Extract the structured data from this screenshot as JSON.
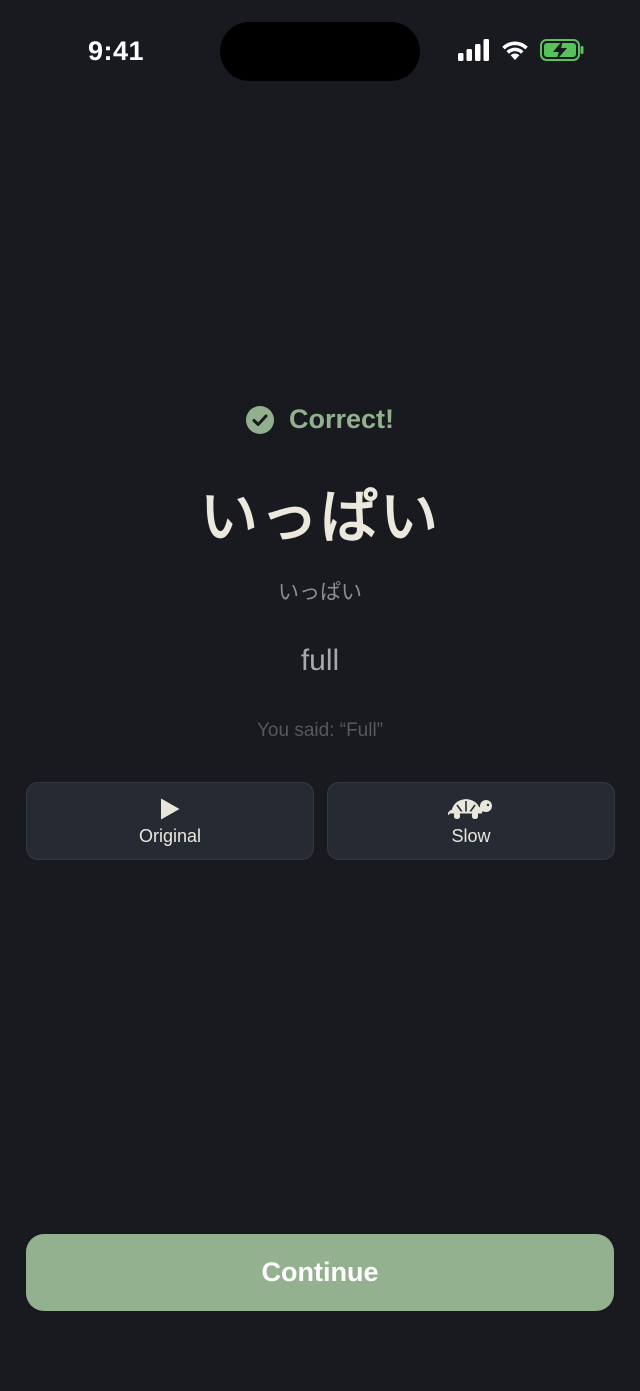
{
  "status_bar": {
    "time": "9:41",
    "icons": [
      "cellular-signal-icon",
      "wifi-icon",
      "battery-charging-icon"
    ]
  },
  "feedback": {
    "icon": "check-circle-icon",
    "text": "Correct!",
    "color": "#93b08e"
  },
  "card": {
    "word": "いっぱい",
    "reading": "いっぱい",
    "meaning": "full",
    "you_said": "You said: “Full”"
  },
  "audio_buttons": {
    "original": {
      "icon": "play-icon",
      "label": "Original"
    },
    "slow": {
      "icon": "turtle-icon",
      "label": "Slow"
    }
  },
  "continue": {
    "label": "Continue",
    "color": "#94b18f"
  },
  "colors": {
    "background": "#181a1f",
    "button_bg": "#262b33",
    "accent": "#93b08e"
  }
}
